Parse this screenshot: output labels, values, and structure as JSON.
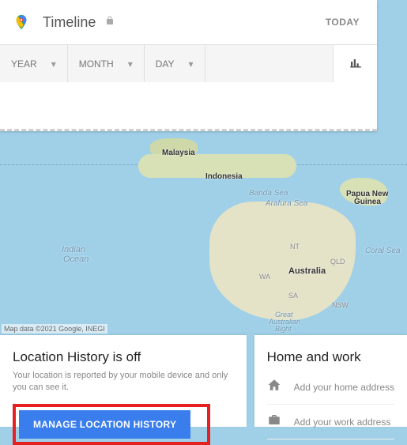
{
  "header": {
    "title": "Timeline",
    "today_label": "TODAY"
  },
  "dropdowns": {
    "year": "YEAR",
    "month": "MONTH",
    "day": "DAY"
  },
  "map": {
    "attribution": "Map data ©2021 Google, INEGI",
    "labels": {
      "malaysia": "Malaysia",
      "indonesia": "Indonesia",
      "banda_sea": "Banda Sea",
      "arafura_sea": "Arafura Sea",
      "png1": "Papua New",
      "png2": "Guinea",
      "indian1": "Indian",
      "indian2": "Ocean",
      "coral_sea": "Coral Sea",
      "australia": "Australia",
      "nt": "NT",
      "qld": "QLD",
      "wa": "WA",
      "sa": "SA",
      "nsw": "NSW",
      "gab1": "Great",
      "gab2": "Australian",
      "gab3": "Bight"
    }
  },
  "location_card": {
    "title": "Location History is off",
    "desc": "Your location is reported by your mobile device and only you can see it.",
    "button": "MANAGE LOCATION HISTORY"
  },
  "homework": {
    "title": "Home and work",
    "home": "Add your home address",
    "work": "Add your work address"
  }
}
